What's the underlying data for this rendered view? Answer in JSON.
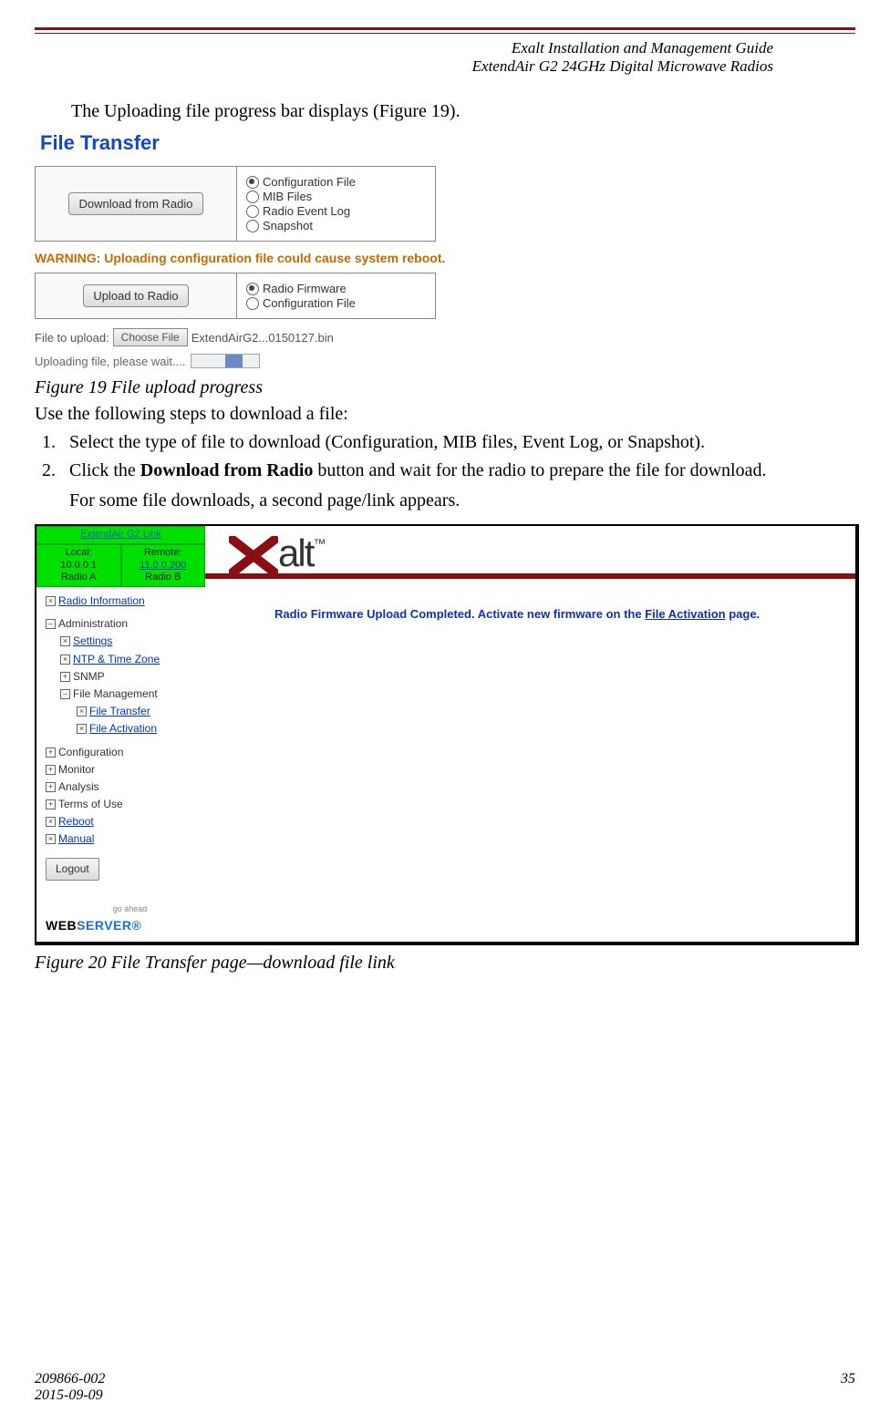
{
  "header": {
    "line1": "Exalt Installation and Management Guide",
    "line2": "ExtendAir G2 24GHz Digital Microwave Radios"
  },
  "intro_text": "The Uploading file progress bar displays (Figure 19).",
  "fig19": {
    "title": "File Transfer",
    "download_button": "Download from Radio",
    "download_options": [
      "Configuration File",
      "MIB Files",
      "Radio Event Log",
      "Snapshot"
    ],
    "download_selected_index": 0,
    "warning": "WARNING: Uploading configuration file could cause system reboot.",
    "upload_button": "Upload to Radio",
    "upload_options": [
      "Radio Firmware",
      "Configuration File"
    ],
    "upload_selected_index": 0,
    "file_label": "File to upload:",
    "choose_button": "Choose File",
    "chosen_file": "ExtendAirG2...0150127.bin",
    "uploading_text": "Uploading file, please wait...."
  },
  "caption19": "Figure 19   File upload progress",
  "instructions_intro": "Use the following steps to download a file:",
  "step1": "Select the type of file to download (Configuration, MIB files, Event Log, or Snapshot).",
  "step2_pre": "Click the ",
  "step2_bold": "Download from Radio",
  "step2_post": " button and wait for the radio to prepare the file for download.",
  "step2_sub": "For some file downloads, a second page/link appears.",
  "fig20": {
    "link_header": "ExtendAir G2 Link",
    "local": {
      "label": "Local:",
      "ip": "10.0.0.1",
      "name": "Radio A"
    },
    "remote": {
      "label": "Remote:",
      "ip": "11.0.0.200",
      "name": "Radio B"
    },
    "logo_text": "alt",
    "nav": {
      "radio_info": "Radio Information",
      "administration": "Administration",
      "settings": "Settings",
      "ntp": "NTP & Time Zone",
      "snmp": "SNMP",
      "file_mgmt": "File Management",
      "file_transfer": "File Transfer",
      "file_activation": "File Activation",
      "configuration": "Configuration",
      "monitor": "Monitor",
      "analysis": "Analysis",
      "terms": "Terms of Use",
      "reboot": "Reboot",
      "manual": "Manual",
      "logout": "Logout"
    },
    "webserver_go": "go ahead",
    "webserver_web": "WEB",
    "webserver_srv": "SERVER",
    "message_pre": "Radio Firmware Upload Completed. Activate new firmware on the ",
    "message_link": "File Activation",
    "message_post": " page."
  },
  "caption20": "Figure 20   File Transfer page—download file link",
  "footer": {
    "docnum": "209866-002",
    "date": "2015-09-09",
    "pagenum": "35"
  }
}
